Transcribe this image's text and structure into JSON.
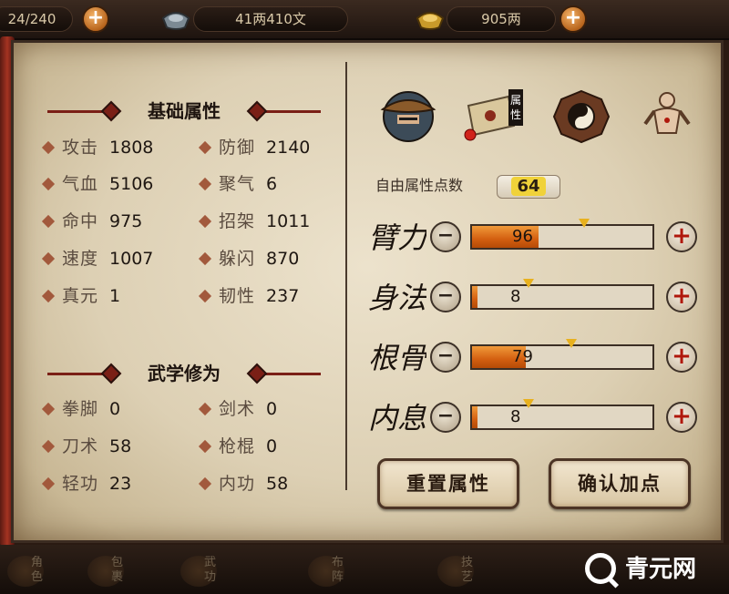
{
  "top": {
    "energy": "24/240",
    "silver": "41两410文",
    "gold": "905两"
  },
  "left": {
    "basic_title": "基础属性",
    "basic": [
      {
        "label": "攻击",
        "value": "1808"
      },
      {
        "label": "防御",
        "value": "2140"
      },
      {
        "label": "气血",
        "value": "5106"
      },
      {
        "label": "聚气",
        "value": "6"
      },
      {
        "label": "命中",
        "value": "975"
      },
      {
        "label": "招架",
        "value": "1011"
      },
      {
        "label": "速度",
        "value": "1007"
      },
      {
        "label": "躲闪",
        "value": "870"
      },
      {
        "label": "真元",
        "value": "1"
      },
      {
        "label": "韧性",
        "value": "237"
      }
    ],
    "martial_title": "武学修为",
    "martial": [
      {
        "label": "拳脚",
        "value": "0"
      },
      {
        "label": "剑术",
        "value": "0"
      },
      {
        "label": "刀术",
        "value": "58"
      },
      {
        "label": "枪棍",
        "value": "0"
      },
      {
        "label": "轻功",
        "value": "23"
      },
      {
        "label": "内功",
        "value": "58"
      }
    ]
  },
  "right": {
    "tab_badge": "属性",
    "free_points_label": "自由属性点数",
    "free_points": "64",
    "attributes": [
      {
        "name": "臂力",
        "value": "96",
        "fill": 0.37
      },
      {
        "name": "身法",
        "value": "8",
        "fill": 0.03
      },
      {
        "name": "根骨",
        "value": "79",
        "fill": 0.3
      },
      {
        "name": "内息",
        "value": "8",
        "fill": 0.03
      }
    ],
    "reset_label": "重置属性",
    "confirm_label": "确认加点"
  },
  "nav": [
    {
      "label": "角色"
    },
    {
      "label": "包裹"
    },
    {
      "label": "武功"
    },
    {
      "label": "布阵"
    },
    {
      "label": "技艺"
    }
  ],
  "watermark": "青元网",
  "colors": {
    "parchment": "#e6dbc3",
    "bar_fill": "#d35f10",
    "title_red": "#7a1f16"
  }
}
